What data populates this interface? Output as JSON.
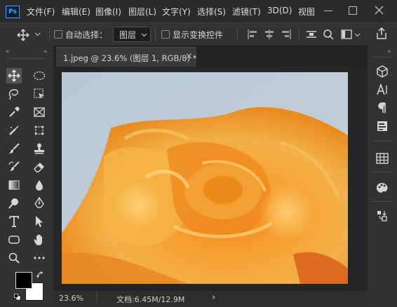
{
  "app": {
    "logo_text": "Ps"
  },
  "menu": [
    "文件(F)",
    "编辑(E)",
    "图像(I)",
    "图层(L)",
    "文字(Y)",
    "选择(S)",
    "滤镜(T)",
    "3D(D)",
    "视图"
  ],
  "options": {
    "auto_select_label": "自动选择：",
    "auto_select_value": "图层",
    "show_transform_label": "显示变换控件"
  },
  "document": {
    "tab_title": "1.jpeg @ 23.6% (图层 1, RGB/8) *",
    "close_glyph": "×"
  },
  "status": {
    "zoom": "23.6%",
    "doc_size": "文档:6.45M/12.9M",
    "arrow": "›"
  },
  "icons": {
    "left_tools": [
      "move-icon",
      "marquee-icon",
      "lasso-icon",
      "object-select-icon",
      "eyedropper-icon",
      "crop-icon",
      "spot-heal-icon",
      "frame-icon",
      "brush-icon",
      "stamp-icon",
      "history-brush-icon",
      "eraser-icon",
      "gradient-icon",
      "blur-icon",
      "dodge-icon",
      "pen-icon",
      "type-icon",
      "path-select-icon",
      "shape-icon",
      "hand-icon",
      "zoom-icon",
      "more-icon"
    ],
    "right_panels": [
      "3d-icon",
      "character-icon",
      "paragraph-icon",
      "properties-icon",
      "table-icon",
      "swatch-icon",
      "history-icon"
    ]
  },
  "colors": {
    "foreground": "#000000",
    "background": "#ffffff",
    "accent": "#31a8ff"
  }
}
